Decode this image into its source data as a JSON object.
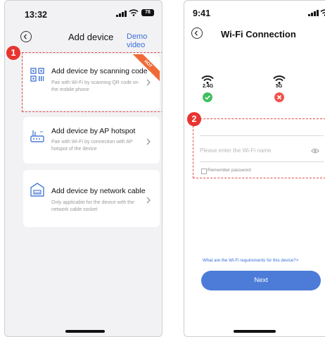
{
  "left_screen": {
    "status": {
      "time": "13:32",
      "battery": "78"
    },
    "header": {
      "title": "Add device",
      "demo_label": "Demo video"
    },
    "step_badge": "1",
    "cards": [
      {
        "title": "Add device by scanning code",
        "description": "Pair with Wi-Fi by scanning QR code on the mobile phone",
        "tag": "HOT"
      },
      {
        "title": "Add device by AP hotspot",
        "description": "Pair with Wi-Fi by connection with AP hotspot of the device"
      },
      {
        "title": "Add device by network cable",
        "description": "Only applicable for the device with the network cable socket"
      }
    ]
  },
  "right_screen": {
    "status": {
      "time": "9:41"
    },
    "header": {
      "title": "Wi-Fi Connection"
    },
    "bands": [
      {
        "label": "2.4G",
        "status": "supported"
      },
      {
        "label": "5G",
        "status": "unsupported"
      }
    ],
    "step_badge": "2",
    "form": {
      "ssid_value": "",
      "password_placeholder": "Please enter the Wi-Fi name",
      "remember_label": "Remember password"
    },
    "requirements_link": "What are the Wi-Fi requirements for this device?>",
    "next_label": "Next"
  },
  "colors": {
    "accent": "#4c7cd8",
    "highlight": "#e04a4a",
    "success": "#3fbf5f",
    "error": "#f0524a",
    "hot": "#f06a36"
  }
}
